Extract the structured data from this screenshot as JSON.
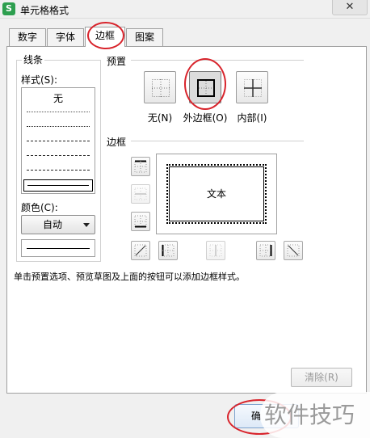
{
  "window": {
    "title": "单元格格式",
    "close_icon": "close-icon",
    "app_icon_letter": "S",
    "accent": "#2d9f4f"
  },
  "tabs": [
    {
      "label": "数字"
    },
    {
      "label": "字体"
    },
    {
      "label": "边框",
      "active": true
    },
    {
      "label": "图案"
    }
  ],
  "line_group": {
    "title": "线条",
    "style_label": "样式(S):",
    "style_none": "无",
    "color_label": "颜色(C):",
    "color_value": "自动"
  },
  "preset": {
    "title": "预置",
    "items": [
      {
        "label": "无(N)",
        "icon": "border-none-icon"
      },
      {
        "label": "外边框(O)",
        "icon": "border-outline-icon",
        "pressed": true
      },
      {
        "label": "内部(I)",
        "icon": "border-inside-icon"
      }
    ]
  },
  "border": {
    "title": "边框",
    "preview_text": "文本"
  },
  "hint": "单击预置选项、预览草图及上面的按钮可以添加边框样式。",
  "buttons": {
    "clear": "清除(R)",
    "ok": "确"
  },
  "watermark": "软件技巧",
  "highlight_color": "#d8242c"
}
